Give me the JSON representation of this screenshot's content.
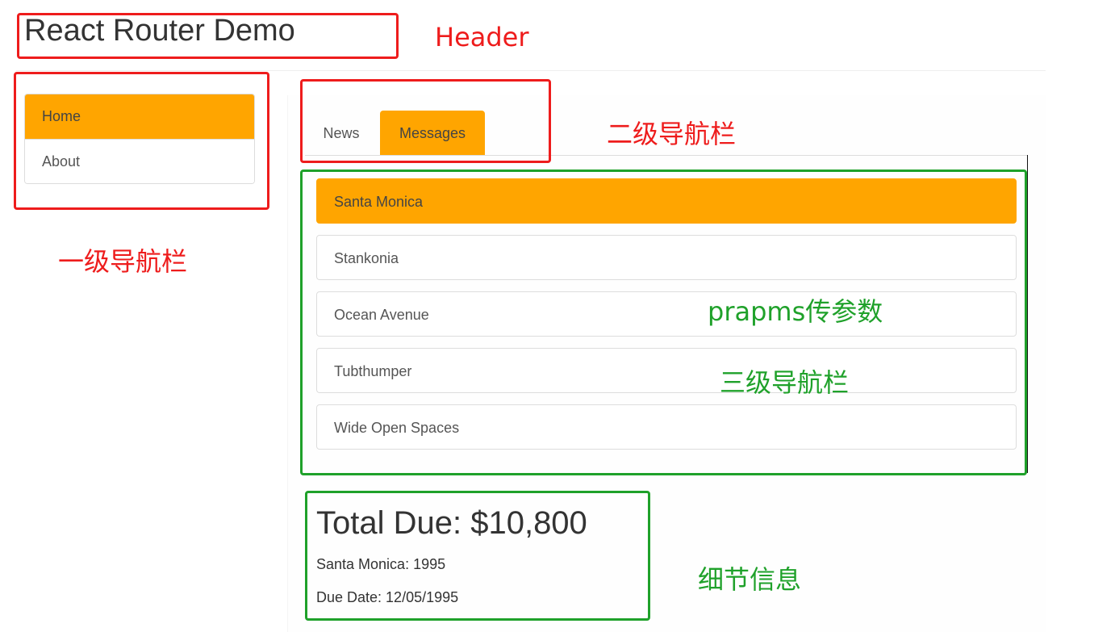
{
  "header": {
    "title": "React Router Demo"
  },
  "nav_level1": {
    "items": [
      {
        "label": "Home",
        "active": true
      },
      {
        "label": "About",
        "active": false
      }
    ]
  },
  "nav_level2": {
    "tabs": [
      {
        "label": "News",
        "active": false
      },
      {
        "label": "Messages",
        "active": true
      }
    ]
  },
  "nav_level3": {
    "items": [
      {
        "label": "Santa Monica",
        "active": true
      },
      {
        "label": "Stankonia",
        "active": false
      },
      {
        "label": "Ocean Avenue",
        "active": false
      },
      {
        "label": "Tubthumper",
        "active": false
      },
      {
        "label": "Wide Open Spaces",
        "active": false
      }
    ]
  },
  "detail": {
    "title": "Total Due: $10,800",
    "line1": "Santa Monica: 1995",
    "line2": "Due Date: 12/05/1995"
  },
  "annotations": {
    "header": "Header",
    "nav_level1": "一级导航栏",
    "nav_level2": "二级导航栏",
    "params": "prapms传参数",
    "nav_level3": "三级导航栏",
    "detail": "细节信息"
  },
  "colors": {
    "active_bg": "#ffa500",
    "annotation_red": "#ee1c1c",
    "annotation_green": "#1fa12a",
    "border": "#dddddd"
  }
}
